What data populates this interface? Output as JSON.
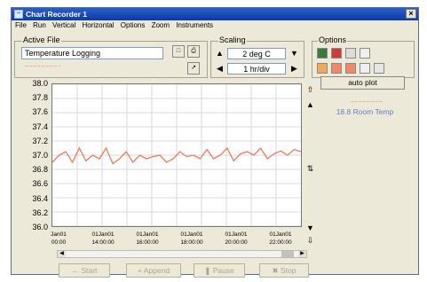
{
  "window": {
    "title": "Chart Recorder 1",
    "close_glyph": "×"
  },
  "menu": [
    "File",
    "Run",
    "Vertical",
    "Horizontal",
    "Options",
    "Zoom",
    "Instruments"
  ],
  "active_file": {
    "label": "Active File",
    "value": "Temperature Logging",
    "path_text": "~~~~~~~~~"
  },
  "scaling": {
    "label": "Scaling",
    "vertical_value": "2 deg C",
    "horizontal_value": "1 hr/div"
  },
  "options": {
    "label": "Options"
  },
  "auto_plot_label": "auto plot",
  "legend": {
    "value_text": "~~~~~~~~",
    "series_text": "18.8 Room Temp"
  },
  "chart_data": {
    "type": "line",
    "yticks": [
      "38.0",
      "37.8",
      "37.6",
      "37.4",
      "37.2",
      "37.0",
      "36.8",
      "36.6",
      "36.4",
      "36.2",
      "36.0"
    ],
    "ylim": [
      36.0,
      38.0
    ],
    "xticks": [
      {
        "date": "Jan01",
        "time": "00:00"
      },
      {
        "date": "01Jan01",
        "time": "14:00:00"
      },
      {
        "date": "01Jan01",
        "time": "16:00:00"
      },
      {
        "date": "01Jan01",
        "time": "18:00:00"
      },
      {
        "date": "01Jan01",
        "time": "20:00:00"
      },
      {
        "date": "01Jan01",
        "time": "22:00:00"
      }
    ],
    "series": [
      {
        "color": "#f07a5a",
        "values": [
          36.9,
          37.0,
          37.05,
          36.9,
          37.1,
          36.92,
          37.0,
          36.95,
          37.1,
          36.88,
          36.95,
          37.05,
          36.9,
          37.0,
          36.95,
          36.98,
          37.0,
          36.9,
          36.95,
          37.05,
          36.98,
          37.0,
          36.95,
          37.08,
          36.95,
          37.0,
          37.1,
          36.92,
          37.02,
          37.05,
          37.0,
          37.1,
          36.95,
          37.02,
          37.06,
          37.0,
          37.08,
          37.05
        ]
      }
    ],
    "grid": true
  },
  "buttons": {
    "start": "Start",
    "append": "Append",
    "pause": "Pause",
    "stop": "Stop"
  },
  "colors": {
    "title_bar": "#0b3ba8",
    "series": "#f07a5a",
    "legend_series": "#5b7fd0"
  }
}
